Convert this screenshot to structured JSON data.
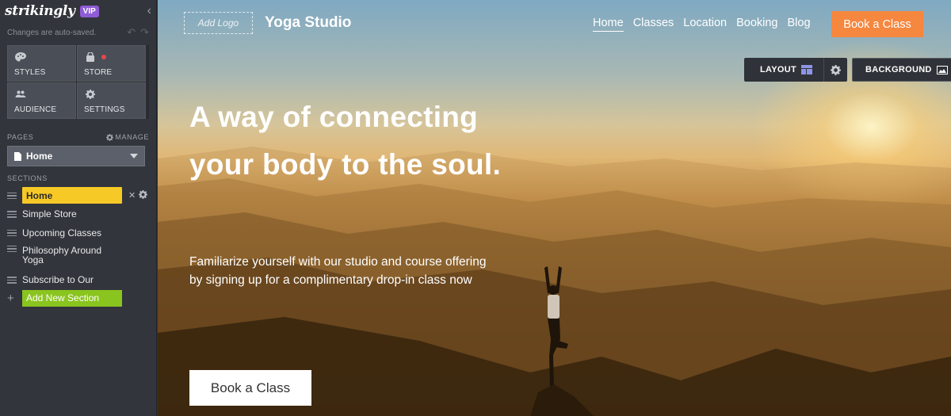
{
  "sidebar": {
    "brand": "strikingly",
    "badge": "VIP",
    "autosave_text": "Changes are auto-saved.",
    "tiles": [
      {
        "label": "STYLES",
        "icon": "palette-icon"
      },
      {
        "label": "STORE",
        "icon": "shopping-bag-icon"
      },
      {
        "label": "AUDIENCE",
        "icon": "people-icon"
      },
      {
        "label": "SETTINGS",
        "icon": "gear-icon"
      }
    ],
    "pages_header": "PAGES",
    "manage_label": "MANAGE",
    "current_page": "Home",
    "sections_header": "SECTIONS",
    "sections": [
      "Home",
      "Simple Store",
      "Upcoming Classes",
      "Philosophy Around Yoga",
      "Subscribe to Our"
    ],
    "add_section_label": "Add New Section"
  },
  "site": {
    "logo_placeholder": "Add Logo",
    "title": "Yoga Studio",
    "nav": [
      "Home",
      "Classes",
      "Location",
      "Booking",
      "Blog"
    ],
    "nav_cta": "Book a Class",
    "hero_title": "A way of connecting your body to the soul.",
    "hero_subtitle": "Familiarize yourself with our studio and course offering by signing up for a complimentary drop-in class now",
    "hero_cta": "Book a Class"
  },
  "editor": {
    "layout_label": "LAYOUT",
    "background_label": "BACKGROUND"
  },
  "colors": {
    "active_section": "#f7c926",
    "add_section": "#8ac41f",
    "cta": "#f5873f",
    "vip": "#8f5bd6",
    "sidebar_bg": "#32353b"
  }
}
